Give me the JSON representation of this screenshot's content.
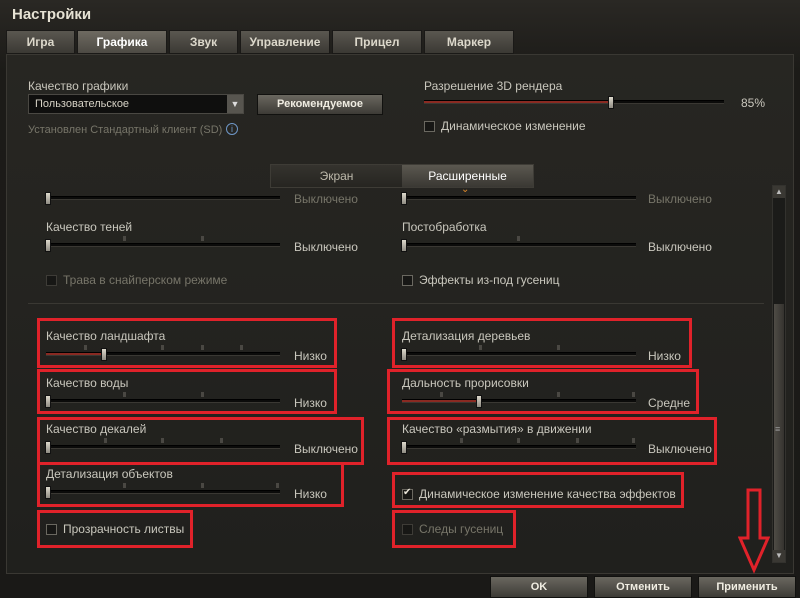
{
  "window": {
    "title": "Настройки"
  },
  "tabs": [
    "Игра",
    "Графика",
    "Звук",
    "Управление",
    "Прицел",
    "Маркер"
  ],
  "graphics_quality": {
    "label": "Качество графики",
    "value": "Пользовательское",
    "recommended_button": "Рекомендуемое",
    "client_note": "Установлен Стандартный клиент (SD)",
    "info_icon": "info-icon"
  },
  "render_resolution": {
    "label": "Разрешение 3D рендера",
    "value_text": "85%",
    "value": 0.85,
    "dynamic_label": "Динамическое изменение",
    "dynamic_checked": false
  },
  "subtabs": [
    "Экран",
    "Расширенные"
  ],
  "cut_row": {
    "left_value": "Выключено",
    "right_value": "Выключено"
  },
  "settings": {
    "shadow_quality": {
      "label": "Качество теней",
      "value": "Выключено",
      "level": 0
    },
    "postprocessing": {
      "label": "Постобработка",
      "value": "Выключено",
      "level": 0
    },
    "grass_sniper": {
      "label": "Трава в снайперском режиме",
      "checked": false
    },
    "track_effects": {
      "label": "Эффекты из-под гусениц",
      "checked": false
    },
    "terrain_quality": {
      "label": "Качество ландшафта",
      "value": "Низко",
      "level": 0.25
    },
    "water_quality": {
      "label": "Качество воды",
      "value": "Низко",
      "level": 0
    },
    "decal_quality": {
      "label": "Качество декалей",
      "value": "Выключено",
      "level": 0
    },
    "object_detail": {
      "label": "Детализация объектов",
      "value": "Низко",
      "level": 0
    },
    "foliage_transparency": {
      "label": "Прозрачность листвы",
      "checked": false
    },
    "tree_detail": {
      "label": "Детализация деревьев",
      "value": "Низко",
      "level": 0
    },
    "draw_distance": {
      "label": "Дальность прорисовки",
      "value": "Средне",
      "level": 0.333
    },
    "motion_blur": {
      "label": "Качество «размытия» в движении",
      "value": "Выключено",
      "level": 0
    },
    "dynamic_effects": {
      "label": "Динамическое изменение качества эффектов",
      "checked": true
    },
    "tank_tracks": {
      "label": "Следы гусениц",
      "checked": false
    }
  },
  "footer": {
    "ok": "OK",
    "cancel": "Отменить",
    "apply": "Применить"
  },
  "colors": {
    "highlight": "#e0222a",
    "accent": "#e08a2a",
    "fill": "#8a2a22"
  }
}
